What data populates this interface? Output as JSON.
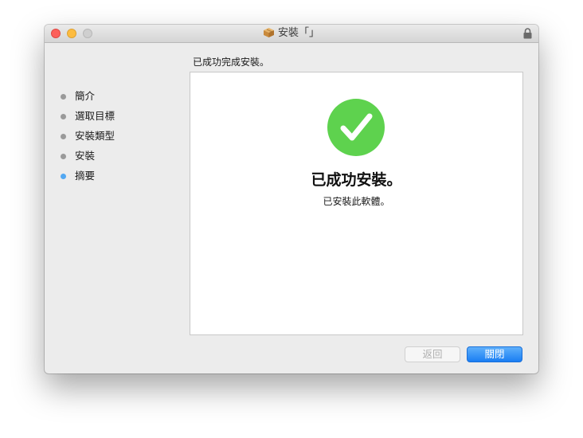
{
  "window": {
    "title": "安裝「」",
    "heading": "已成功完成安裝。"
  },
  "sidebar": {
    "steps": [
      {
        "label": "簡介",
        "active": false
      },
      {
        "label": "選取目標",
        "active": false
      },
      {
        "label": "安裝類型",
        "active": false
      },
      {
        "label": "安裝",
        "active": false
      },
      {
        "label": "摘要",
        "active": true
      }
    ]
  },
  "panel": {
    "title": "已成功安裝。",
    "subtitle": "已安裝此軟體。"
  },
  "buttons": {
    "back_label": "返回",
    "close_label": "關閉"
  },
  "colors": {
    "check_green": "#5ed24e",
    "active_step": "#52a8f2",
    "primary_button": "#1a7ef3"
  },
  "icons": {
    "title_icon": "package-icon",
    "lock": "lock-icon",
    "success": "checkmark-icon"
  }
}
